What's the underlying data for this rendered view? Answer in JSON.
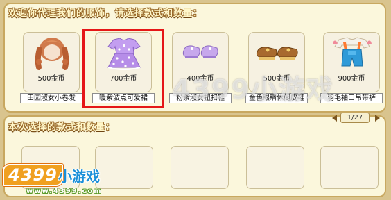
{
  "header": {
    "title": "欢迎你代理我们的服饰，请选择款式和数量："
  },
  "items": [
    {
      "price": "500金币",
      "name": "田园淑女小卷发",
      "icon": "curly-hair-icon"
    },
    {
      "price": "700金币",
      "name": "暖紫波点可爱裙",
      "icon": "purple-dress-icon",
      "selected": true
    },
    {
      "price": "400金币",
      "name": "粉紫淑女扭扣鞋",
      "icon": "purple-shoes-icon"
    },
    {
      "price": "500金币",
      "name": "金色眼睛休闲皮鞋",
      "icon": "brown-shoes-icon"
    },
    {
      "price": "900金币",
      "name": "羽毛袖口吊带裤",
      "icon": "overalls-icon"
    }
  ],
  "pager": {
    "text": "1/27"
  },
  "selection": {
    "title": "本次选择的款式和数量："
  },
  "watermark": {
    "text": "4399小游戏"
  },
  "brand": {
    "number": "4399",
    "name": "小游戏",
    "url": "www.4399.com"
  },
  "colors": {
    "highlight": "#e51717",
    "panel": "#fbf7dc",
    "frame": "#d9c48e"
  }
}
